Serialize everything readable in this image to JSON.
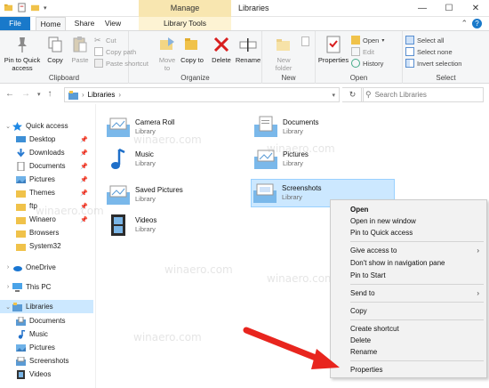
{
  "window": {
    "manage_label": "Manage",
    "title": "Libraries",
    "controls": [
      "—",
      "☐",
      "✕"
    ]
  },
  "ribbon_tabs": {
    "file": "File",
    "home": "Home",
    "share": "Share",
    "view": "View",
    "library_tools": "Library Tools"
  },
  "ribbon": {
    "clipboard": {
      "label": "Clipboard",
      "pin": "Pin to Quick access",
      "copy": "Copy",
      "paste": "Paste",
      "cut": "Cut",
      "copy_path": "Copy path",
      "paste_shortcut": "Paste shortcut"
    },
    "organize": {
      "label": "Organize",
      "move_to": "Move to",
      "copy_to": "Copy to",
      "delete": "Delete",
      "rename": "Rename"
    },
    "new": {
      "label": "New",
      "new_folder": "New folder"
    },
    "open": {
      "label": "Open",
      "properties": "Properties",
      "open": "Open",
      "edit": "Edit",
      "history": "History"
    },
    "select": {
      "label": "Select",
      "select_all": "Select all",
      "select_none": "Select none",
      "invert": "Invert selection"
    }
  },
  "address": {
    "path": "Libraries",
    "search_placeholder": "Search Libraries"
  },
  "sidebar": {
    "items": [
      {
        "label": "Quick access",
        "level": 0
      },
      {
        "label": "Desktop",
        "level": 1,
        "pinned": true
      },
      {
        "label": "Downloads",
        "level": 1,
        "pinned": true
      },
      {
        "label": "Documents",
        "level": 1,
        "pinned": true
      },
      {
        "label": "Pictures",
        "level": 1,
        "pinned": true
      },
      {
        "label": "Themes",
        "level": 1,
        "pinned": true
      },
      {
        "label": "ftp",
        "level": 1,
        "pinned": true
      },
      {
        "label": "Winaero",
        "level": 1,
        "pinned": true
      },
      {
        "label": "Browsers",
        "level": 1
      },
      {
        "label": "System32",
        "level": 1
      },
      {
        "label": "OneDrive",
        "level": 0
      },
      {
        "label": "This PC",
        "level": 0
      },
      {
        "label": "Libraries",
        "level": 0
      },
      {
        "label": "Documents",
        "level": 1
      },
      {
        "label": "Music",
        "level": 1
      },
      {
        "label": "Pictures",
        "level": 1
      },
      {
        "label": "Screenshots",
        "level": 1
      },
      {
        "label": "Videos",
        "level": 1
      }
    ]
  },
  "libraries": [
    {
      "name": "Camera Roll",
      "type": "Library"
    },
    {
      "name": "Documents",
      "type": "Library"
    },
    {
      "name": "Music",
      "type": "Library"
    },
    {
      "name": "Pictures",
      "type": "Library"
    },
    {
      "name": "Saved Pictures",
      "type": "Library"
    },
    {
      "name": "Screenshots",
      "type": "Library"
    },
    {
      "name": "Videos",
      "type": "Library"
    }
  ],
  "context_menu": {
    "open": "Open",
    "open_new_window": "Open in new window",
    "pin_quick": "Pin to Quick access",
    "give_access": "Give access to",
    "dont_show": "Don't show in navigation pane",
    "pin_start": "Pin to Start",
    "send_to": "Send to",
    "copy": "Copy",
    "create_shortcut": "Create shortcut",
    "delete": "Delete",
    "rename": "Rename",
    "properties": "Properties"
  },
  "watermark": "winaero.com",
  "colors": {
    "accent": "#1979ca",
    "selection": "#cce8ff",
    "arrow": "#e8251e"
  }
}
